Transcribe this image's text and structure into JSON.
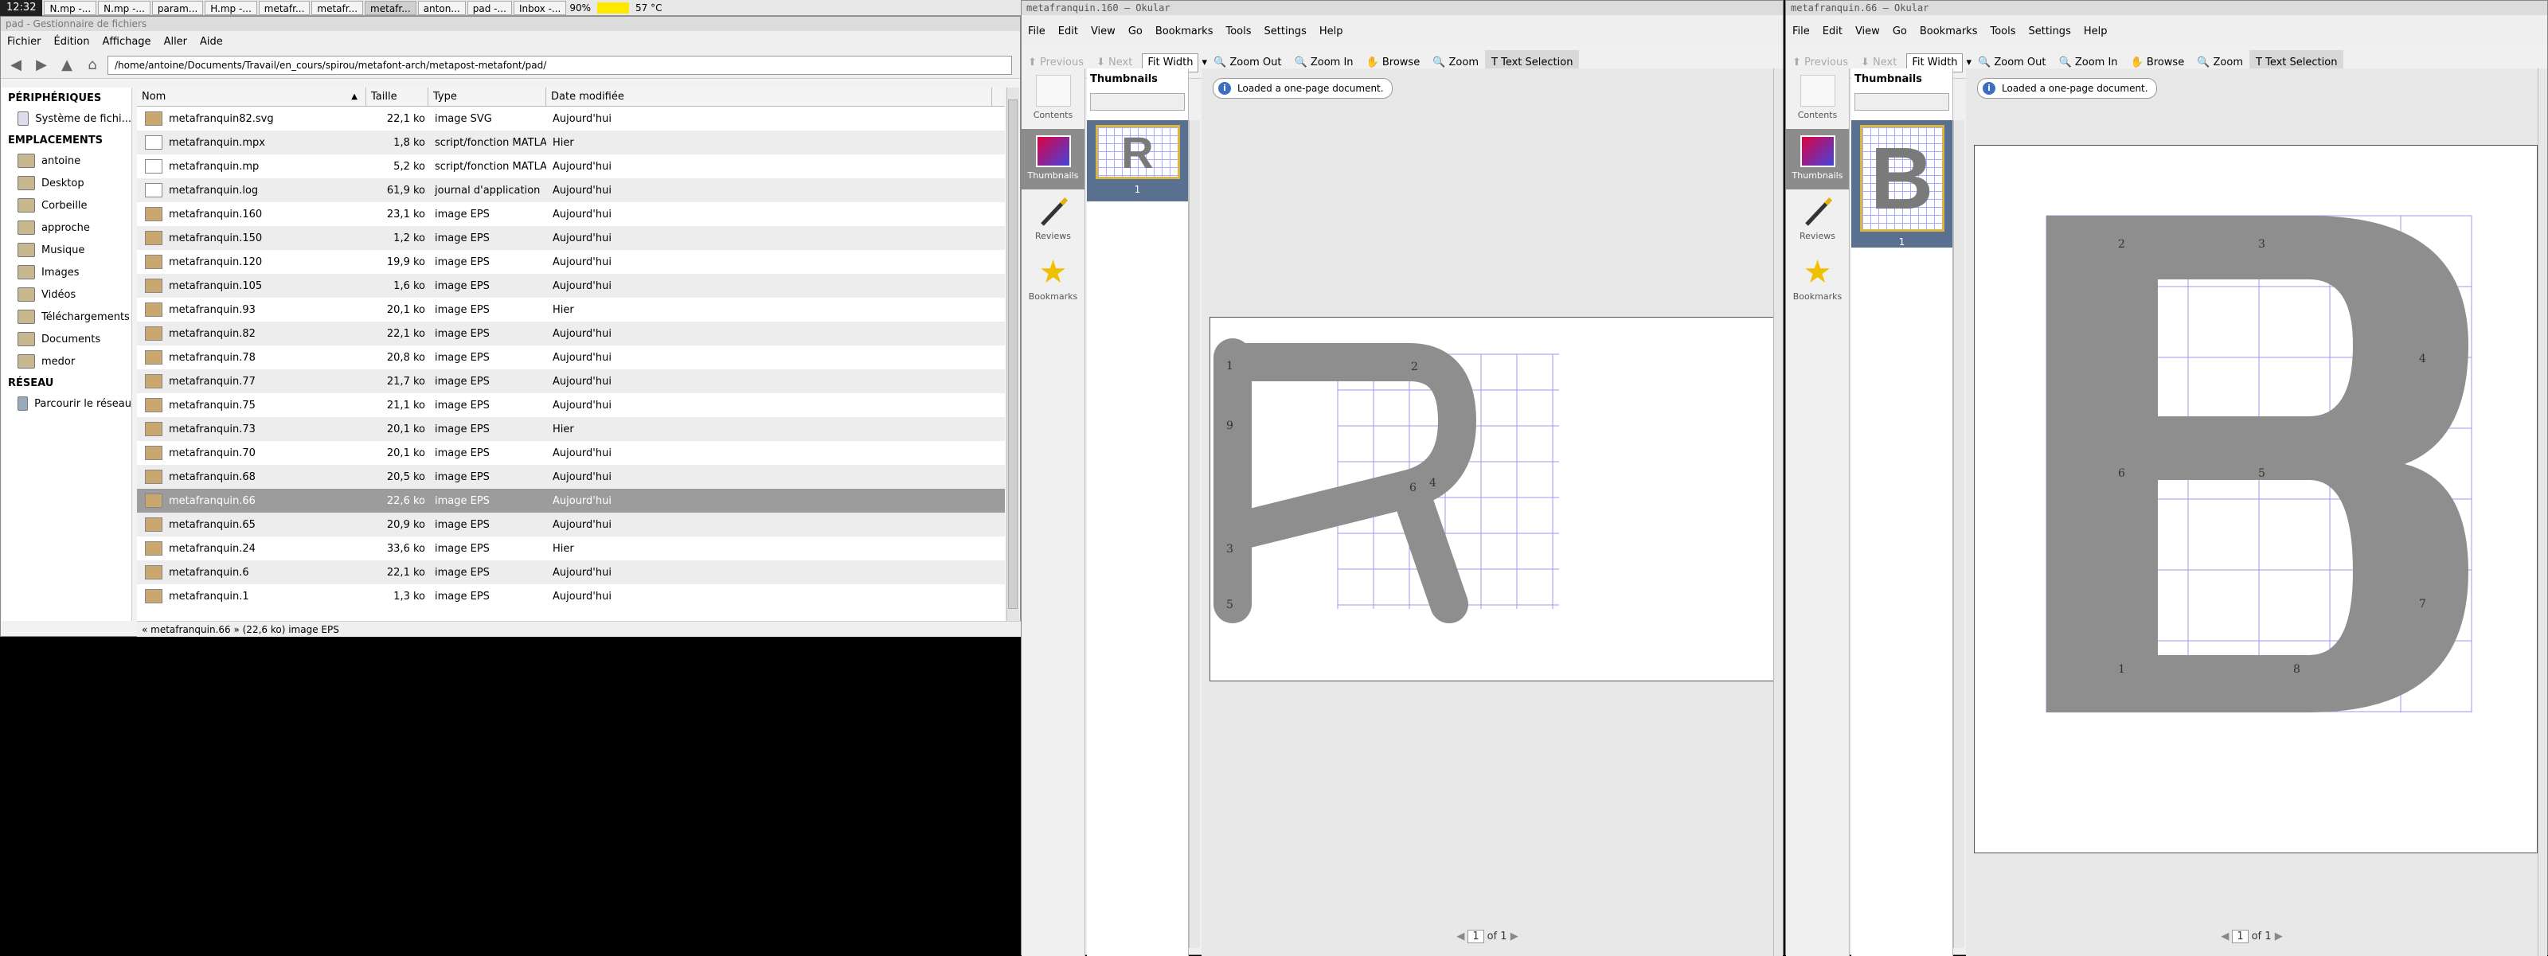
{
  "taskbar": {
    "clock": "12:32",
    "tasks": [
      "N.mp -...",
      "N.mp -...",
      "param...",
      "H.mp -...",
      "metafr...",
      "metafr...",
      "metafr...",
      "anton...",
      "pad -...",
      "Inbox -..."
    ],
    "battery": "90%",
    "temp": "57 °C"
  },
  "filemanager": {
    "title": "pad - Gestionnaire de fichiers",
    "menu": [
      "Fichier",
      "Édition",
      "Affichage",
      "Aller",
      "Aide"
    ],
    "path": "/home/antoine/Documents/Travail/en_cours/spirou/metafont-arch/metapost-metafont/pad/",
    "sidebar": {
      "devices_heading": "PÉRIPHÉRIQUES",
      "devices": [
        "Système de fichi..."
      ],
      "places_heading": "EMPLACEMENTS",
      "places": [
        "antoine",
        "Desktop",
        "Corbeille",
        "approche",
        "Musique",
        "Images",
        "Vidéos",
        "Téléchargements",
        "Documents",
        "medor"
      ],
      "network_heading": "RÉSEAU",
      "network": [
        "Parcourir le réseau"
      ]
    },
    "columns": {
      "name": "Nom",
      "size": "Taille",
      "type": "Type",
      "date": "Date modifiée"
    },
    "files": [
      {
        "name": "metafranquin82.svg",
        "size": "22,1 ko",
        "type": "image SVG",
        "date": "Aujourd'hui"
      },
      {
        "name": "metafranquin.mpx",
        "size": "1,8 ko",
        "type": "script/fonction MATLAB",
        "date": "Hier"
      },
      {
        "name": "metafranquin.mp",
        "size": "5,2 ko",
        "type": "script/fonction MATLAB",
        "date": "Aujourd'hui"
      },
      {
        "name": "metafranquin.log",
        "size": "61,9 ko",
        "type": "journal d'application",
        "date": "Aujourd'hui"
      },
      {
        "name": "metafranquin.160",
        "size": "23,1 ko",
        "type": "image EPS",
        "date": "Aujourd'hui"
      },
      {
        "name": "metafranquin.150",
        "size": "1,2 ko",
        "type": "image EPS",
        "date": "Aujourd'hui"
      },
      {
        "name": "metafranquin.120",
        "size": "19,9 ko",
        "type": "image EPS",
        "date": "Aujourd'hui"
      },
      {
        "name": "metafranquin.105",
        "size": "1,6 ko",
        "type": "image EPS",
        "date": "Aujourd'hui"
      },
      {
        "name": "metafranquin.93",
        "size": "20,1 ko",
        "type": "image EPS",
        "date": "Hier"
      },
      {
        "name": "metafranquin.82",
        "size": "22,1 ko",
        "type": "image EPS",
        "date": "Aujourd'hui"
      },
      {
        "name": "metafranquin.78",
        "size": "20,8 ko",
        "type": "image EPS",
        "date": "Aujourd'hui"
      },
      {
        "name": "metafranquin.77",
        "size": "21,7 ko",
        "type": "image EPS",
        "date": "Aujourd'hui"
      },
      {
        "name": "metafranquin.75",
        "size": "21,1 ko",
        "type": "image EPS",
        "date": "Aujourd'hui"
      },
      {
        "name": "metafranquin.73",
        "size": "20,1 ko",
        "type": "image EPS",
        "date": "Hier"
      },
      {
        "name": "metafranquin.70",
        "size": "20,1 ko",
        "type": "image EPS",
        "date": "Aujourd'hui"
      },
      {
        "name": "metafranquin.68",
        "size": "20,5 ko",
        "type": "image EPS",
        "date": "Aujourd'hui"
      },
      {
        "name": "metafranquin.66",
        "size": "22,6 ko",
        "type": "image EPS",
        "date": "Aujourd'hui"
      },
      {
        "name": "metafranquin.65",
        "size": "20,9 ko",
        "type": "image EPS",
        "date": "Aujourd'hui"
      },
      {
        "name": "metafranquin.24",
        "size": "33,6 ko",
        "type": "image EPS",
        "date": "Hier"
      },
      {
        "name": "metafranquin.6",
        "size": "22,1 ko",
        "type": "image EPS",
        "date": "Aujourd'hui"
      },
      {
        "name": "metafranquin.1",
        "size": "1,3 ko",
        "type": "image EPS",
        "date": "Aujourd'hui"
      }
    ],
    "selected_index": 16,
    "status": "« metafranquin.66 » (22,6 ko) image EPS"
  },
  "okular_left": {
    "title": "metafranquin.160 — Okular",
    "glyph": "R",
    "page_labels": [
      "1",
      "9",
      "3",
      "5",
      "2",
      "6",
      "4"
    ]
  },
  "okular_right": {
    "title": "metafranquin.66 — Okular",
    "glyph": "B",
    "page_labels": [
      "2",
      "3",
      "4",
      "6",
      "5",
      "7",
      "1",
      "8"
    ]
  },
  "okular_common": {
    "menu": [
      "File",
      "Edit",
      "View",
      "Go",
      "Bookmarks",
      "Tools",
      "Settings",
      "Help"
    ],
    "previous": "Previous",
    "next": "Next",
    "fit": "Fit Width",
    "zoom_out": "Zoom Out",
    "zoom_in": "Zoom In",
    "browse": "Browse",
    "zoom": "Zoom",
    "text_selection": "Text Selection",
    "side_contents": "Contents",
    "side_thumbnails": "Thumbnails",
    "side_reviews": "Reviews",
    "side_bookmarks": "Bookmarks",
    "thumbnails_title": "Thumbnails",
    "thumb_page": "1",
    "message": "Loaded a one-page document.",
    "page_current": "1",
    "page_of": "of",
    "page_total": "1"
  },
  "colors": {
    "glyph": "#8e8e8e",
    "grid": "#8e8ef0",
    "thumb_selected": "#5a7090",
    "row_selected": "#9c9c9c"
  }
}
